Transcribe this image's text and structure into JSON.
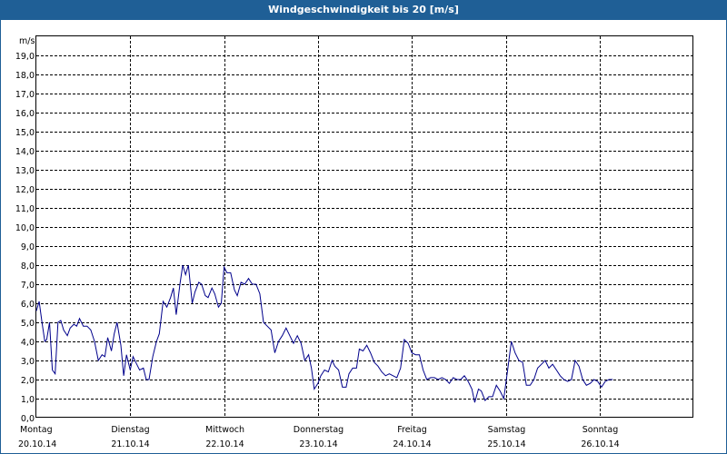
{
  "window": {
    "title": "Windgeschwindigkeit bis 20 [m/s]"
  },
  "colors": {
    "title_bar": "#1f5f96",
    "series_line": "#00008b",
    "grid": "#000000"
  },
  "chart_data": {
    "type": "line",
    "title": "Windgeschwindigkeit bis 20 [m/s]",
    "ylabel": "m/s",
    "xlabel": "",
    "ylim": [
      0,
      20
    ],
    "y_ticks": [
      "0,0",
      "1,0",
      "2,0",
      "3,0",
      "4,0",
      "5,0",
      "6,0",
      "7,0",
      "8,0",
      "9,0",
      "10,0",
      "11,0",
      "12,0",
      "13,0",
      "14,0",
      "15,0",
      "16,0",
      "17,0",
      "18,0",
      "19,0"
    ],
    "y_tick_values": [
      0,
      1,
      2,
      3,
      4,
      5,
      6,
      7,
      8,
      9,
      10,
      11,
      12,
      13,
      14,
      15,
      16,
      17,
      18,
      19
    ],
    "x_days": [
      {
        "weekday": "Montag",
        "date": "20.10.14"
      },
      {
        "weekday": "Dienstag",
        "date": "21.10.14"
      },
      {
        "weekday": "Mittwoch",
        "date": "22.10.14"
      },
      {
        "weekday": "Donnerstag",
        "date": "23.10.14"
      },
      {
        "weekday": "Freitag",
        "date": "24.10.14"
      },
      {
        "weekday": "Samstag",
        "date": "25.10.14"
      },
      {
        "weekday": "Sonntag",
        "date": "26.10.14"
      }
    ],
    "grid": true,
    "series": [
      {
        "x_unit": "days from 20.10.14 00:00",
        "points": [
          [
            0.0,
            5.6
          ],
          [
            0.03,
            6.1
          ],
          [
            0.06,
            5.0
          ],
          [
            0.09,
            4.0
          ],
          [
            0.11,
            4.1
          ],
          [
            0.14,
            5.0
          ],
          [
            0.17,
            2.5
          ],
          [
            0.2,
            2.3
          ],
          [
            0.23,
            5.0
          ],
          [
            0.26,
            5.1
          ],
          [
            0.29,
            4.6
          ],
          [
            0.33,
            4.3
          ],
          [
            0.36,
            4.7
          ],
          [
            0.4,
            4.9
          ],
          [
            0.43,
            4.8
          ],
          [
            0.46,
            5.2
          ],
          [
            0.5,
            4.8
          ],
          [
            0.54,
            4.8
          ],
          [
            0.58,
            4.6
          ],
          [
            0.62,
            4.0
          ],
          [
            0.66,
            3.0
          ],
          [
            0.7,
            3.3
          ],
          [
            0.73,
            3.2
          ],
          [
            0.76,
            4.2
          ],
          [
            0.8,
            3.5
          ],
          [
            0.83,
            4.4
          ],
          [
            0.86,
            5.0
          ],
          [
            0.9,
            3.8
          ],
          [
            0.93,
            2.2
          ],
          [
            0.96,
            3.3
          ],
          [
            1.0,
            2.5
          ],
          [
            1.03,
            3.2
          ],
          [
            1.07,
            2.8
          ],
          [
            1.1,
            2.5
          ],
          [
            1.14,
            2.6
          ],
          [
            1.17,
            2.0
          ],
          [
            1.2,
            2.0
          ],
          [
            1.24,
            3.2
          ],
          [
            1.28,
            4.0
          ],
          [
            1.31,
            4.4
          ],
          [
            1.35,
            6.1
          ],
          [
            1.39,
            5.8
          ],
          [
            1.43,
            6.3
          ],
          [
            1.46,
            6.8
          ],
          [
            1.49,
            5.4
          ],
          [
            1.53,
            7.0
          ],
          [
            1.56,
            8.0
          ],
          [
            1.59,
            7.5
          ],
          [
            1.62,
            8.0
          ],
          [
            1.66,
            6.0
          ],
          [
            1.69,
            6.6
          ],
          [
            1.73,
            7.1
          ],
          [
            1.76,
            7.0
          ],
          [
            1.8,
            6.4
          ],
          [
            1.83,
            6.3
          ],
          [
            1.87,
            6.8
          ],
          [
            1.9,
            6.5
          ],
          [
            1.94,
            5.8
          ],
          [
            1.97,
            6.0
          ],
          [
            2.0,
            7.9
          ],
          [
            2.03,
            7.6
          ],
          [
            2.07,
            7.6
          ],
          [
            2.11,
            6.7
          ],
          [
            2.14,
            6.4
          ],
          [
            2.18,
            7.1
          ],
          [
            2.22,
            7.0
          ],
          [
            2.26,
            7.3
          ],
          [
            2.3,
            7.0
          ],
          [
            2.34,
            7.0
          ],
          [
            2.38,
            6.5
          ],
          [
            2.42,
            5.0
          ],
          [
            2.46,
            4.8
          ],
          [
            2.5,
            4.6
          ],
          [
            2.54,
            3.4
          ],
          [
            2.58,
            4.0
          ],
          [
            2.62,
            4.3
          ],
          [
            2.66,
            4.7
          ],
          [
            2.7,
            4.3
          ],
          [
            2.74,
            3.9
          ],
          [
            2.78,
            4.3
          ],
          [
            2.82,
            3.9
          ],
          [
            2.86,
            3.0
          ],
          [
            2.9,
            3.3
          ],
          [
            2.93,
            2.6
          ],
          [
            2.96,
            1.5
          ],
          [
            3.0,
            1.8
          ],
          [
            3.03,
            2.2
          ],
          [
            3.07,
            2.5
          ],
          [
            3.11,
            2.4
          ],
          [
            3.15,
            3.0
          ],
          [
            3.18,
            2.7
          ],
          [
            3.22,
            2.5
          ],
          [
            3.26,
            1.6
          ],
          [
            3.3,
            1.6
          ],
          [
            3.33,
            2.3
          ],
          [
            3.37,
            2.6
          ],
          [
            3.41,
            2.6
          ],
          [
            3.44,
            3.6
          ],
          [
            3.48,
            3.5
          ],
          [
            3.52,
            3.8
          ],
          [
            3.56,
            3.4
          ],
          [
            3.6,
            2.9
          ],
          [
            3.64,
            2.7
          ],
          [
            3.68,
            2.4
          ],
          [
            3.72,
            2.2
          ],
          [
            3.76,
            2.3
          ],
          [
            3.8,
            2.2
          ],
          [
            3.84,
            2.1
          ],
          [
            3.88,
            2.6
          ],
          [
            3.92,
            4.1
          ],
          [
            3.96,
            3.9
          ],
          [
            4.0,
            3.4
          ],
          [
            4.04,
            3.3
          ],
          [
            4.08,
            3.3
          ],
          [
            4.12,
            2.5
          ],
          [
            4.16,
            2.0
          ],
          [
            4.2,
            2.1
          ],
          [
            4.24,
            2.1
          ],
          [
            4.28,
            2.0
          ],
          [
            4.32,
            2.1
          ],
          [
            4.36,
            2.0
          ],
          [
            4.4,
            1.8
          ],
          [
            4.44,
            2.1
          ],
          [
            4.48,
            2.0
          ],
          [
            4.52,
            2.0
          ],
          [
            4.56,
            2.2
          ],
          [
            4.6,
            1.9
          ],
          [
            4.64,
            1.5
          ],
          [
            4.67,
            0.8
          ],
          [
            4.71,
            1.5
          ],
          [
            4.74,
            1.4
          ],
          [
            4.78,
            0.9
          ],
          [
            4.82,
            1.1
          ],
          [
            4.86,
            1.1
          ],
          [
            4.9,
            1.7
          ],
          [
            4.94,
            1.4
          ],
          [
            4.98,
            1.0
          ],
          [
            5.02,
            2.5
          ],
          [
            5.06,
            4.0
          ],
          [
            5.1,
            3.4
          ],
          [
            5.14,
            3.0
          ],
          [
            5.18,
            2.9
          ],
          [
            5.22,
            1.7
          ],
          [
            5.26,
            1.7
          ],
          [
            5.3,
            2.0
          ],
          [
            5.34,
            2.6
          ],
          [
            5.38,
            2.8
          ],
          [
            5.42,
            3.0
          ],
          [
            5.46,
            2.6
          ],
          [
            5.5,
            2.8
          ],
          [
            5.54,
            2.5
          ],
          [
            5.58,
            2.2
          ],
          [
            5.62,
            2.0
          ],
          [
            5.66,
            1.9
          ],
          [
            5.7,
            2.0
          ],
          [
            5.74,
            3.0
          ],
          [
            5.78,
            2.7
          ],
          [
            5.82,
            2.0
          ],
          [
            5.86,
            1.7
          ],
          [
            5.9,
            1.8
          ],
          [
            5.94,
            2.0
          ],
          [
            5.98,
            1.9
          ],
          [
            6.02,
            1.6
          ],
          [
            6.06,
            1.9
          ],
          [
            6.1,
            2.0
          ],
          [
            6.14,
            2.0
          ]
        ]
      }
    ]
  }
}
